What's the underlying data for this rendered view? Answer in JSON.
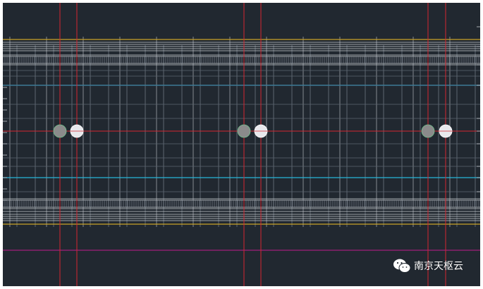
{
  "canvas": {
    "background": "#212830",
    "colors": {
      "yellow": "#c9a227",
      "white_grid": "#c8ccd2",
      "grid_dim": "#5d6670",
      "steel": "#3d7a96",
      "cyan": "#27b6d9",
      "red_axis": "#d5262f",
      "magenta": "#a01e79",
      "circle_gray": "#8b8b8b",
      "circle_light": "#e8e8ec",
      "tick": "#8f96a0"
    }
  },
  "watermark": {
    "text": "南京天枢云",
    "icon": "wechat-icon"
  }
}
